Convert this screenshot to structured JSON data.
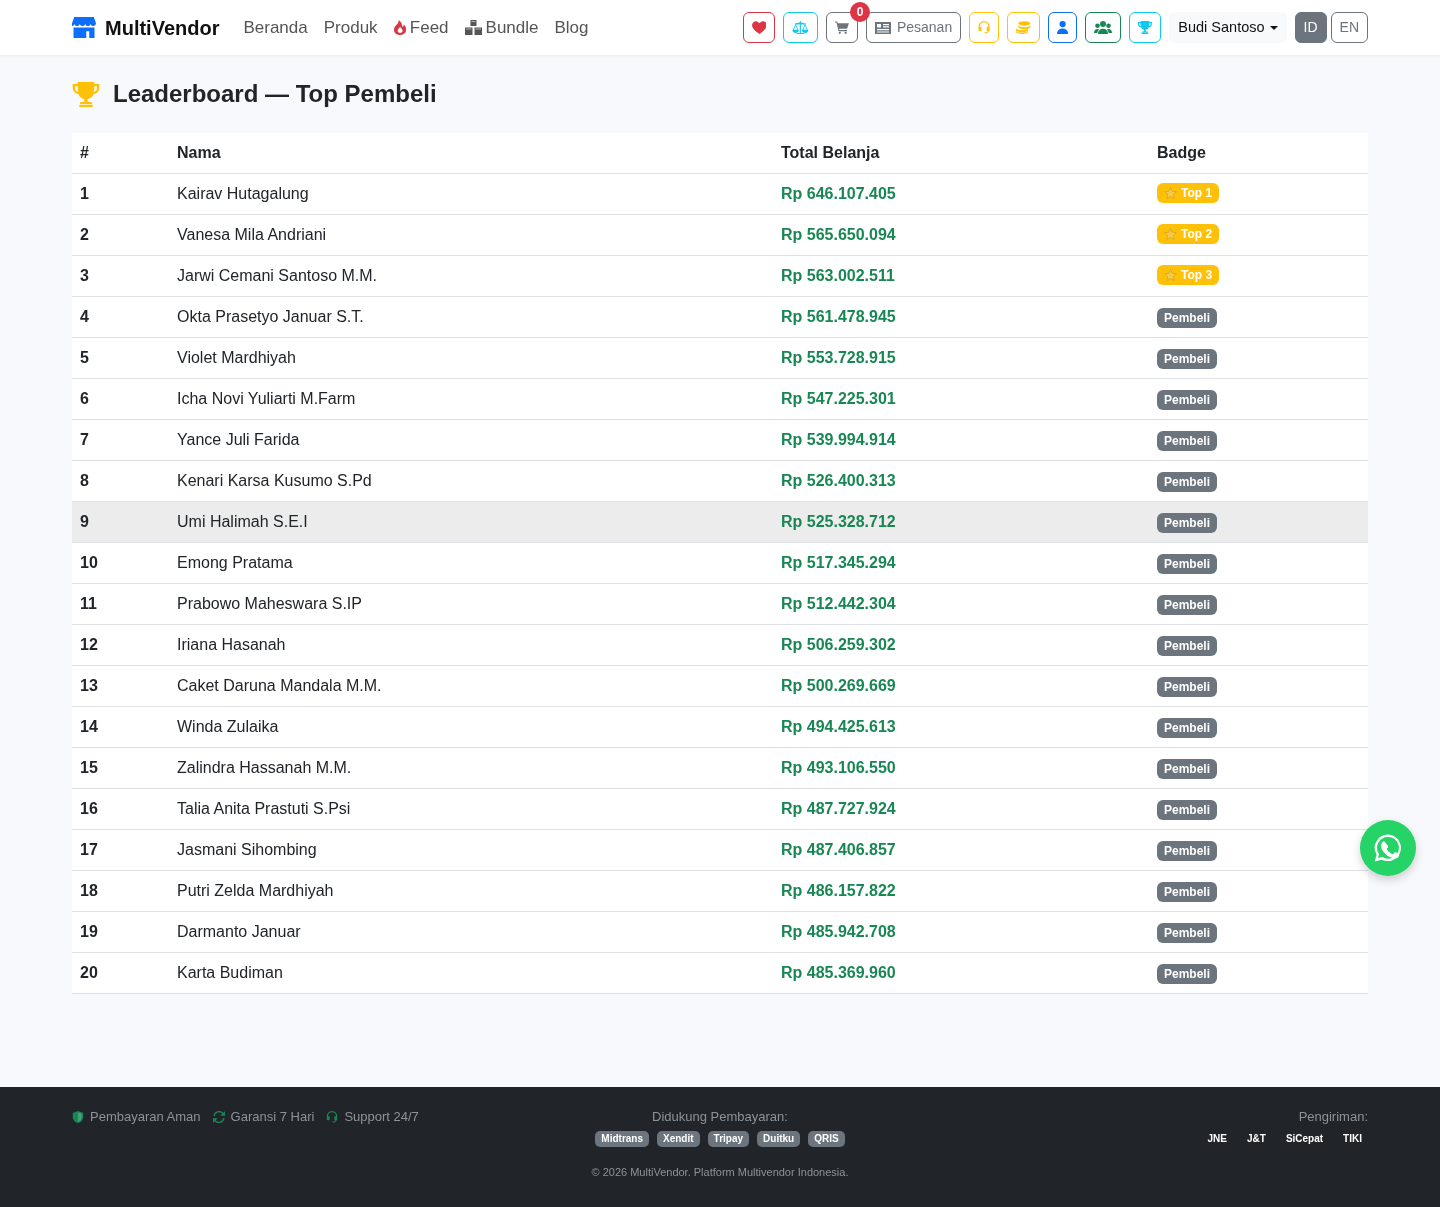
{
  "navbar": {
    "brand": "MultiVendor",
    "links": [
      {
        "label": "Beranda",
        "kind": "page"
      },
      {
        "label": "Produk",
        "kind": "page"
      },
      {
        "label": "Feed",
        "kind": "feed"
      },
      {
        "label": "Bundle",
        "kind": "bundle"
      },
      {
        "label": "Blog",
        "kind": "page"
      }
    ],
    "actions": [
      {
        "kind": "wishlist"
      },
      {
        "kind": "compare"
      },
      {
        "kind": "cart",
        "count": "0"
      },
      {
        "kind": "orders",
        "label": "Pesanan"
      },
      {
        "kind": "support"
      },
      {
        "kind": "coins"
      },
      {
        "kind": "profile"
      },
      {
        "kind": "community"
      },
      {
        "kind": "leaderboard"
      }
    ],
    "user_menu": {
      "label": "Budi Santoso"
    },
    "languages": [
      {
        "label": "ID",
        "selected": true
      },
      {
        "label": "EN",
        "selected": false
      }
    ]
  },
  "page": {
    "title": "Leaderboard — Top Pembeli"
  },
  "table": {
    "columns": [
      "#",
      "Nama",
      "Total Belanja",
      "Badge"
    ],
    "rows": [
      {
        "rank": "1",
        "name": "Kairav Hutagalung",
        "total": "Rp 646.107.405",
        "badge": {
          "kind": "top",
          "label": "Top 1"
        },
        "highlighted": false
      },
      {
        "rank": "2",
        "name": "Vanesa Mila Andriani",
        "total": "Rp 565.650.094",
        "badge": {
          "kind": "top",
          "label": "Top 2"
        },
        "highlighted": false
      },
      {
        "rank": "3",
        "name": "Jarwi Cemani Santoso M.M.",
        "total": "Rp 563.002.511",
        "badge": {
          "kind": "top",
          "label": "Top 3"
        },
        "highlighted": false
      },
      {
        "rank": "4",
        "name": "Okta Prasetyo Januar S.T.",
        "total": "Rp 561.478.945",
        "badge": {
          "kind": "member",
          "label": "Pembeli"
        },
        "highlighted": false
      },
      {
        "rank": "5",
        "name": "Violet Mardhiyah",
        "total": "Rp 553.728.915",
        "badge": {
          "kind": "member",
          "label": "Pembeli"
        },
        "highlighted": false
      },
      {
        "rank": "6",
        "name": "Icha Novi Yuliarti M.Farm",
        "total": "Rp 547.225.301",
        "badge": {
          "kind": "member",
          "label": "Pembeli"
        },
        "highlighted": false
      },
      {
        "rank": "7",
        "name": "Yance Juli Farida",
        "total": "Rp 539.994.914",
        "badge": {
          "kind": "member",
          "label": "Pembeli"
        },
        "highlighted": false
      },
      {
        "rank": "8",
        "name": "Kenari Karsa Kusumo S.Pd",
        "total": "Rp 526.400.313",
        "badge": {
          "kind": "member",
          "label": "Pembeli"
        },
        "highlighted": false
      },
      {
        "rank": "9",
        "name": "Umi Halimah S.E.I",
        "total": "Rp 525.328.712",
        "badge": {
          "kind": "member",
          "label": "Pembeli"
        },
        "highlighted": true
      },
      {
        "rank": "10",
        "name": "Emong Pratama",
        "total": "Rp 517.345.294",
        "badge": {
          "kind": "member",
          "label": "Pembeli"
        },
        "highlighted": false
      },
      {
        "rank": "11",
        "name": "Prabowo Maheswara S.IP",
        "total": "Rp 512.442.304",
        "badge": {
          "kind": "member",
          "label": "Pembeli"
        },
        "highlighted": false
      },
      {
        "rank": "12",
        "name": "Iriana Hasanah",
        "total": "Rp 506.259.302",
        "badge": {
          "kind": "member",
          "label": "Pembeli"
        },
        "highlighted": false
      },
      {
        "rank": "13",
        "name": "Caket Daruna Mandala M.M.",
        "total": "Rp 500.269.669",
        "badge": {
          "kind": "member",
          "label": "Pembeli"
        },
        "highlighted": false
      },
      {
        "rank": "14",
        "name": "Winda Zulaika",
        "total": "Rp 494.425.613",
        "badge": {
          "kind": "member",
          "label": "Pembeli"
        },
        "highlighted": false
      },
      {
        "rank": "15",
        "name": "Zalindra Hassanah M.M.",
        "total": "Rp 493.106.550",
        "badge": {
          "kind": "member",
          "label": "Pembeli"
        },
        "highlighted": false
      },
      {
        "rank": "16",
        "name": "Talia Anita Prastuti S.Psi",
        "total": "Rp 487.727.924",
        "badge": {
          "kind": "member",
          "label": "Pembeli"
        },
        "highlighted": false
      },
      {
        "rank": "17",
        "name": "Jasmani Sihombing",
        "total": "Rp 487.406.857",
        "badge": {
          "kind": "member",
          "label": "Pembeli"
        },
        "highlighted": false
      },
      {
        "rank": "18",
        "name": "Putri Zelda Mardhiyah",
        "total": "Rp 486.157.822",
        "badge": {
          "kind": "member",
          "label": "Pembeli"
        },
        "highlighted": false
      },
      {
        "rank": "19",
        "name": "Darmanto Januar",
        "total": "Rp 485.942.708",
        "badge": {
          "kind": "member",
          "label": "Pembeli"
        },
        "highlighted": false
      },
      {
        "rank": "20",
        "name": "Karta Budiman",
        "total": "Rp 485.369.960",
        "badge": {
          "kind": "member",
          "label": "Pembeli"
        },
        "highlighted": false
      }
    ]
  },
  "footer": {
    "features": [
      {
        "kind": "secure",
        "label": "Pembayaran Aman"
      },
      {
        "kind": "guarantee",
        "label": "Garansi 7 Hari"
      },
      {
        "kind": "support",
        "label": "Support 24/7"
      }
    ],
    "payments": {
      "title": "Didukung Pembayaran:",
      "methods": [
        "Midtrans",
        "Xendit",
        "Tripay",
        "Duitku",
        "QRIS"
      ]
    },
    "shipping": {
      "title": "Pengiriman:",
      "couriers": [
        "JNE",
        "J&T",
        "SiCepat",
        "TIKI"
      ]
    },
    "copyright": "© 2026 MultiVendor. Platform Multivendor Indonesia."
  }
}
